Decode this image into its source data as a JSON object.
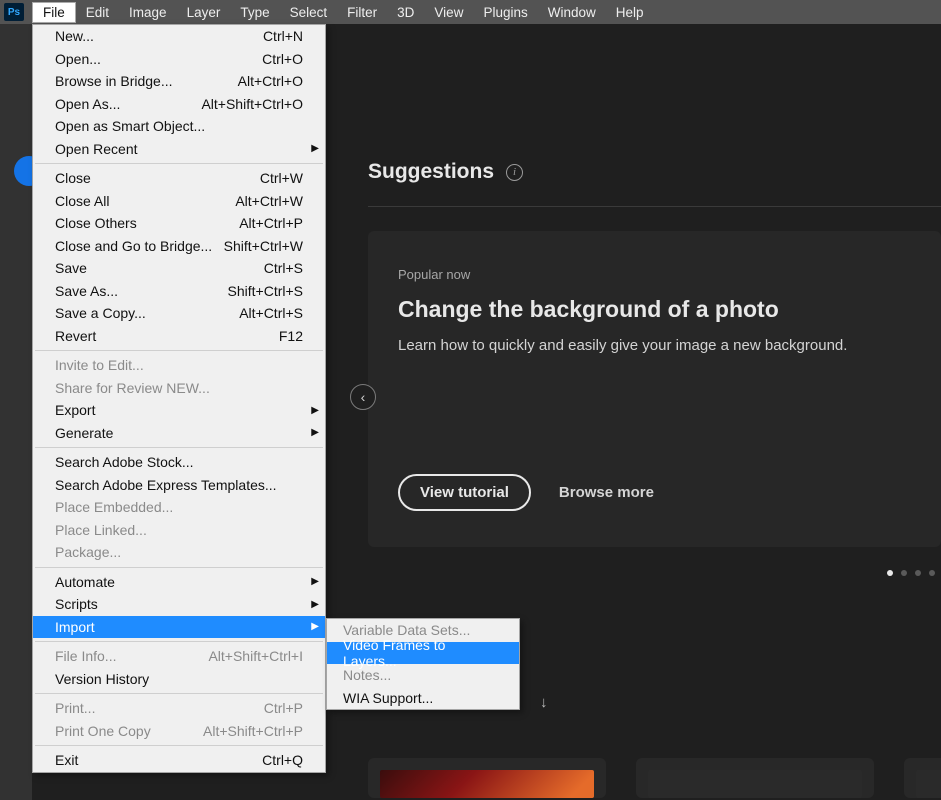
{
  "app_icon": "Ps",
  "menubar": [
    "File",
    "Edit",
    "Image",
    "Layer",
    "Type",
    "Select",
    "Filter",
    "3D",
    "View",
    "Plugins",
    "Window",
    "Help"
  ],
  "file_menu": {
    "groups": [
      [
        {
          "label": "New...",
          "shortcut": "Ctrl+N"
        },
        {
          "label": "Open...",
          "shortcut": "Ctrl+O"
        },
        {
          "label": "Browse in Bridge...",
          "shortcut": "Alt+Ctrl+O"
        },
        {
          "label": "Open As...",
          "shortcut": "Alt+Shift+Ctrl+O"
        },
        {
          "label": "Open as Smart Object..."
        },
        {
          "label": "Open Recent",
          "submenu": true
        }
      ],
      [
        {
          "label": "Close",
          "shortcut": "Ctrl+W"
        },
        {
          "label": "Close All",
          "shortcut": "Alt+Ctrl+W"
        },
        {
          "label": "Close Others",
          "shortcut": "Alt+Ctrl+P"
        },
        {
          "label": "Close and Go to Bridge...",
          "shortcut": "Shift+Ctrl+W"
        },
        {
          "label": "Save",
          "shortcut": "Ctrl+S"
        },
        {
          "label": "Save As...",
          "shortcut": "Shift+Ctrl+S"
        },
        {
          "label": "Save a Copy...",
          "shortcut": "Alt+Ctrl+S"
        },
        {
          "label": "Revert",
          "shortcut": "F12"
        }
      ],
      [
        {
          "label": "Invite to Edit...",
          "disabled": true
        },
        {
          "label": "Share for Review NEW...",
          "disabled": true
        },
        {
          "label": "Export",
          "submenu": true
        },
        {
          "label": "Generate",
          "submenu": true
        }
      ],
      [
        {
          "label": "Search Adobe Stock..."
        },
        {
          "label": "Search Adobe Express Templates..."
        },
        {
          "label": "Place Embedded...",
          "disabled": true
        },
        {
          "label": "Place Linked...",
          "disabled": true
        },
        {
          "label": "Package...",
          "disabled": true
        }
      ],
      [
        {
          "label": "Automate",
          "submenu": true
        },
        {
          "label": "Scripts",
          "submenu": true
        },
        {
          "label": "Import",
          "submenu": true,
          "highlight": true
        }
      ],
      [
        {
          "label": "File Info...",
          "shortcut": "Alt+Shift+Ctrl+I",
          "disabled": true
        },
        {
          "label": "Version History"
        }
      ],
      [
        {
          "label": "Print...",
          "shortcut": "Ctrl+P",
          "disabled": true
        },
        {
          "label": "Print One Copy",
          "shortcut": "Alt+Shift+Ctrl+P",
          "disabled": true
        }
      ],
      [
        {
          "label": "Exit",
          "shortcut": "Ctrl+Q"
        }
      ]
    ]
  },
  "import_submenu": [
    {
      "label": "Variable Data Sets...",
      "disabled": true
    },
    {
      "label": "Video Frames to Layers...",
      "highlight": true
    },
    {
      "label": "Notes...",
      "disabled": true
    },
    {
      "label": "WIA Support..."
    }
  ],
  "suggestions": {
    "title": "Suggestions",
    "popular": "Popular now",
    "headline": "Change the background of a photo",
    "desc": "Learn how to quickly and easily give your image a new background.",
    "view_btn": "View tutorial",
    "browse": "Browse more"
  }
}
